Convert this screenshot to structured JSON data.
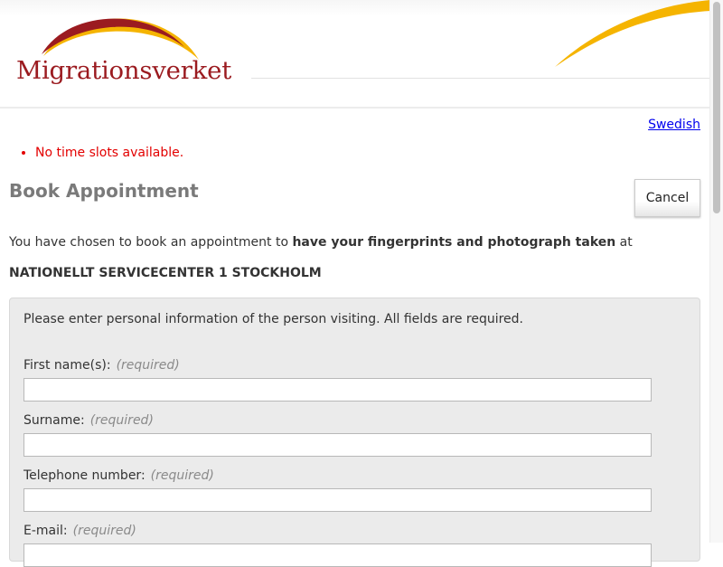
{
  "header": {
    "logo_text": "Migrationsverket"
  },
  "language_link": "Swedish",
  "errors": [
    "No time slots available."
  ],
  "page_title": "Book Appointment",
  "cancel_label": "Cancel",
  "intro": {
    "prefix": "You have chosen to book an appointment to ",
    "emphasis": "have your fingerprints and photograph taken",
    "suffix": " at"
  },
  "location": "NATIONELLT SERVICECENTER 1 STOCKHOLM",
  "form": {
    "instructions": "Please enter personal information of the person visiting. All fields are required.",
    "required_hint": "(required)",
    "fields": [
      {
        "label": "First name(s):",
        "value": ""
      },
      {
        "label": "Surname:",
        "value": ""
      },
      {
        "label": "Telephone number:",
        "value": ""
      },
      {
        "label": "E-mail:",
        "value": ""
      }
    ]
  },
  "colors": {
    "brand_red": "#9b1b20",
    "brand_yellow": "#f5b400",
    "error": "#e30000",
    "link": "#0000ee"
  }
}
